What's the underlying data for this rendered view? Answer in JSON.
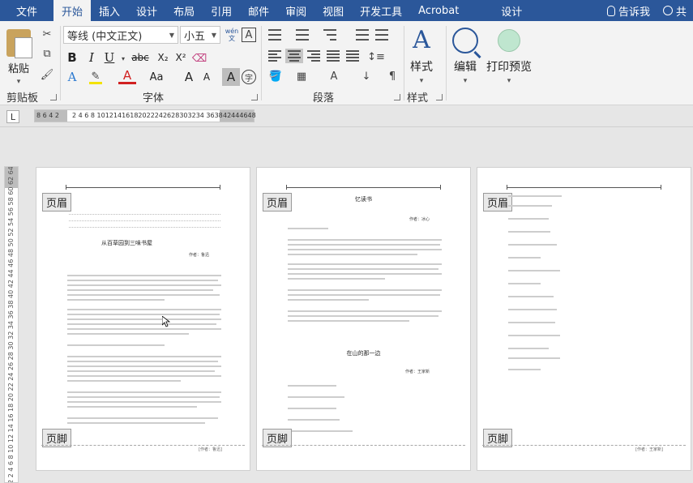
{
  "tabs": [
    "文件",
    "开始",
    "插入",
    "设计",
    "布局",
    "引用",
    "邮件",
    "审阅",
    "视图",
    "开发工具",
    "Acrobat",
    "设计"
  ],
  "active_tab": "开始",
  "tell_me": "告诉我",
  "share": "共",
  "groups": {
    "clipboard": {
      "label": "剪贴板",
      "paste": "粘贴"
    },
    "font": {
      "label": "字体",
      "font_name": "等线 (中文正文)",
      "font_size": "小五",
      "wen": "wén\n文",
      "a_box": "A",
      "bold": "B",
      "italic": "I",
      "underline": "U",
      "strike": "abc",
      "sub": "X₂",
      "sup": "X²",
      "case": "Aa",
      "grow": "A",
      "shrink": "A",
      "shade": "A",
      "circle": "字"
    },
    "paragraph": {
      "label": "段落"
    },
    "styles": {
      "label": "样式",
      "button": "样式"
    },
    "editing": {
      "button": "编辑"
    },
    "print": {
      "button": "打印预览"
    }
  },
  "ruler": {
    "corner": "L",
    "left_nums": "8 6 4 2",
    "main_nums": "2  4  6  8 10121416182022242628303234 3638",
    "right_nums": "42444648"
  },
  "vruler": "2  2  4  6  8  10 12 14 16 18 20 22 24 26 28 30 32 34 36 38 40 42 44 46 48 50 52 54 56 58 60 62 64 66",
  "pages": [
    {
      "header_tag": "页眉",
      "footer_tag": "页脚",
      "title": "从百草园到三味书屋",
      "author": "作者：鲁迅",
      "footer_text": "[作者：鲁迅]"
    },
    {
      "header_tag": "页眉",
      "footer_tag": "页脚",
      "title": "忆读书",
      "author": "作者：冰心",
      "title2": "在山的那一边",
      "author2": "作者：王家新",
      "footer_text": ""
    },
    {
      "header_tag": "页眉",
      "footer_tag": "页脚",
      "footer_text": "[作者：王家新]"
    }
  ]
}
